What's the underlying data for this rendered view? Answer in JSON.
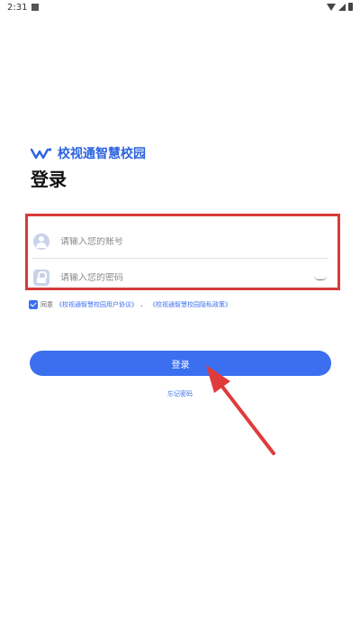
{
  "status_bar": {
    "time": "2:31"
  },
  "brand": {
    "name": "校视通智慧校园",
    "logo_icon": "brand-w-logo",
    "color": "#2b63e0"
  },
  "login": {
    "title": "登录",
    "account_placeholder": "请输入您的账号",
    "password_placeholder": "请输入您的密码",
    "agreement_prefix": "同意",
    "user_agreement": "《校视通智慧校园用户协议》",
    "separator": "、",
    "privacy_policy": "《校视通智慧校园隐私政策》",
    "agreed": true,
    "submit_label": "登录",
    "forgot_label": "忘记密码"
  },
  "colors": {
    "accent": "#3b6ff0",
    "highlight_box": "#d83a3a",
    "arrow": "#e03b3b"
  },
  "icons": [
    "user-icon",
    "lock-icon",
    "eye-toggle-icon",
    "checkbox-checked-icon"
  ]
}
